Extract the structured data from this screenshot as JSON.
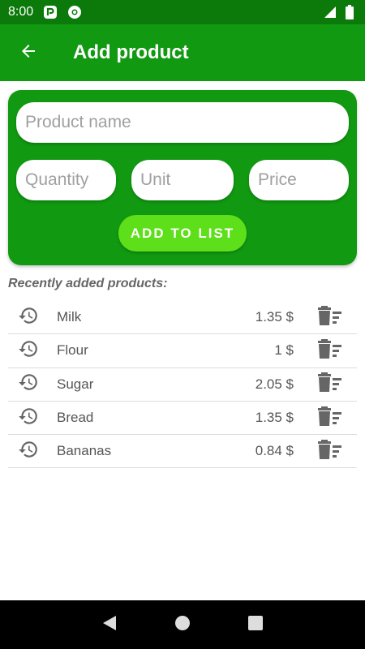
{
  "status_bar": {
    "time": "8:00",
    "icons": [
      "notification-p-icon",
      "chrome-icon",
      "signal-icon",
      "battery-icon"
    ]
  },
  "app_bar": {
    "title": "Add product",
    "back_icon": "arrow-left-icon"
  },
  "form": {
    "product_name_placeholder": "Product name",
    "quantity_placeholder": "Quantity",
    "unit_placeholder": "Unit",
    "price_placeholder": "Price",
    "add_button_label": "ADD TO LIST"
  },
  "recent": {
    "title": "Recently added products:",
    "items": [
      {
        "name": "Milk",
        "price": "1.35 $"
      },
      {
        "name": "Flour",
        "price": "1 $"
      },
      {
        "name": "Sugar",
        "price": "2.05 $"
      },
      {
        "name": "Bread",
        "price": "1.35 $"
      },
      {
        "name": "Bananas",
        "price": "0.84 $"
      }
    ]
  },
  "colors": {
    "status_bar": "#0b7a0b",
    "primary": "#119911",
    "accent_button": "#5ddf1a",
    "icon_gray": "#666666"
  },
  "nav_bar": {
    "icons": [
      "back-triangle-icon",
      "home-circle-icon",
      "recents-square-icon"
    ]
  }
}
